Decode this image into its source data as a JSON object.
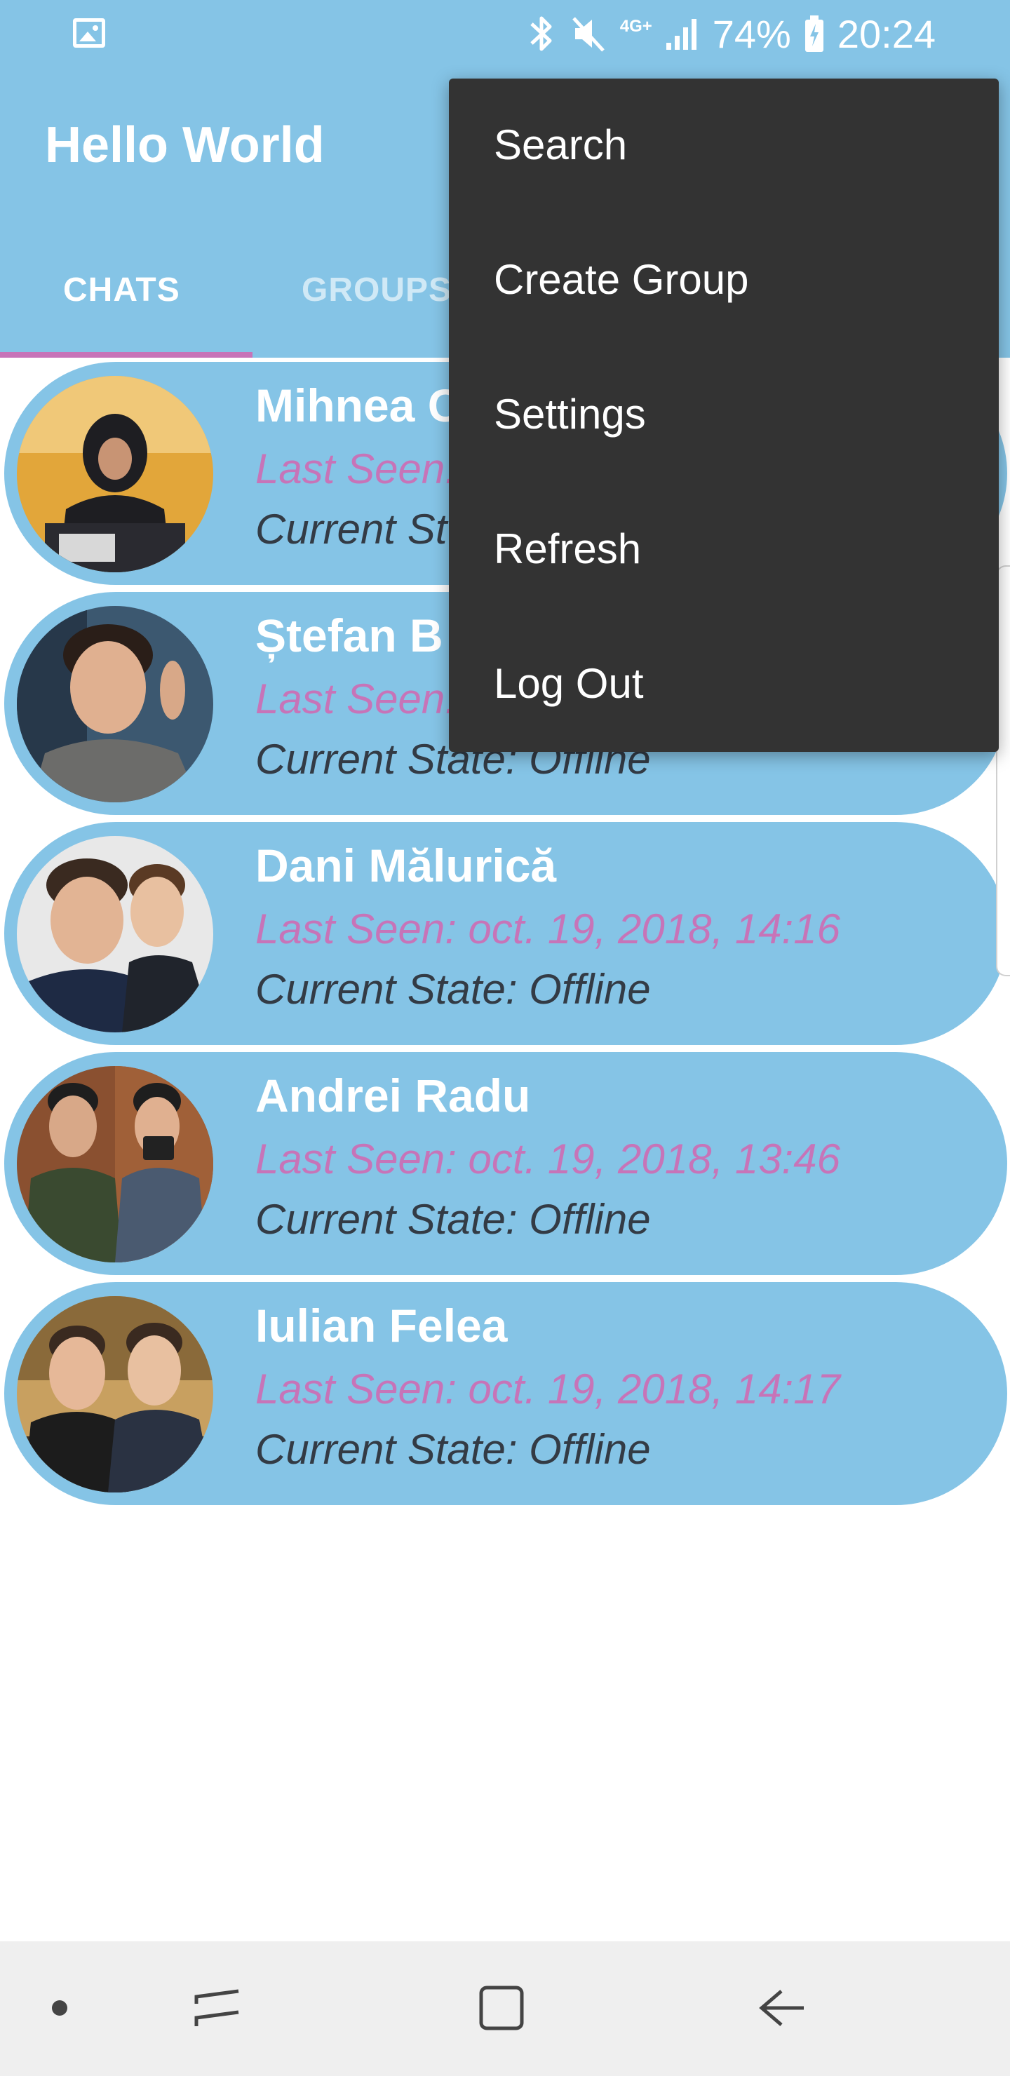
{
  "status_bar": {
    "icons": [
      "gallery-icon",
      "bluetooth-icon",
      "mute-icon",
      "network-4g-icon",
      "signal-icon",
      "battery-icon"
    ],
    "network_label": "4G+",
    "battery": "74%",
    "time": "20:24"
  },
  "app": {
    "title": "Hello World",
    "tabs": [
      {
        "label": "CHATS",
        "active": true
      },
      {
        "label": "GROUPS",
        "active": false
      }
    ]
  },
  "chats": [
    {
      "name": "Mihnea C",
      "last_seen": "Last Seen:",
      "state": "Current St"
    },
    {
      "name": "Ștefan B",
      "last_seen": "Last Seen:",
      "state": "Current State: Offline"
    },
    {
      "name": "Dani Mălurică",
      "last_seen": "Last Seen: oct. 19, 2018, 14:16",
      "state": "Current State: Offline"
    },
    {
      "name": "Andrei Radu",
      "last_seen": "Last Seen: oct. 19, 2018, 13:46",
      "state": "Current State: Offline"
    },
    {
      "name": "Iulian Felea",
      "last_seen": "Last Seen: oct. 19, 2018, 14:17",
      "state": "Current State: Offline"
    }
  ],
  "menu": {
    "items": [
      "Search",
      "Create Group",
      "Settings",
      "Refresh",
      "Log Out"
    ]
  },
  "nav_bar": {
    "icons": [
      "dot-icon",
      "recent-apps-icon",
      "home-icon",
      "back-icon"
    ]
  },
  "colors": {
    "primary": "#85c4e6",
    "accent": "#c774b8",
    "menu_bg": "#333333",
    "state_text": "#333b45"
  }
}
